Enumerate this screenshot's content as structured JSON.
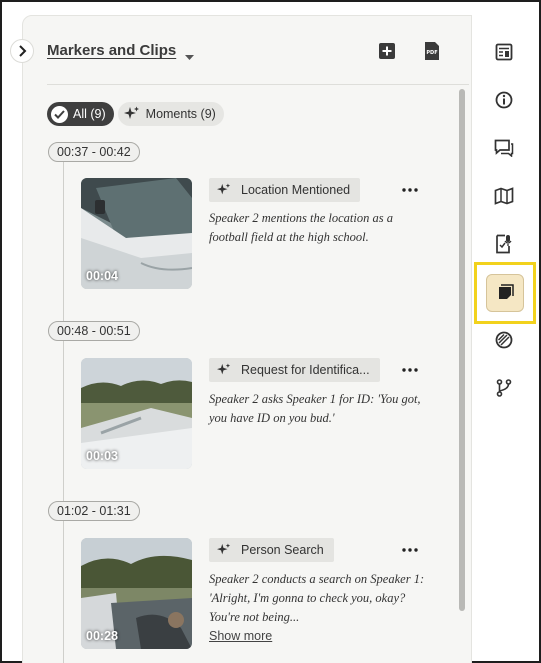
{
  "panel": {
    "title": "Markers and Clips",
    "add_icon": "add-box-icon",
    "pdf_icon": "pdf-export-icon"
  },
  "filters": {
    "all_label": "All (9)",
    "moments_label": "Moments (9)"
  },
  "clips": [
    {
      "time_range": "00:37 - 00:42",
      "thumb_time": "00:04",
      "tag": "Location Mentioned",
      "description": "Speaker 2 mentions the location as a football field at the high school.",
      "show_more": ""
    },
    {
      "time_range": "00:48 - 00:51",
      "thumb_time": "00:03",
      "tag": "Request for Identifica...",
      "description": "Speaker 2 asks Speaker 1 for ID: 'You got, you have ID on you bud.'",
      "show_more": ""
    },
    {
      "time_range": "01:02 - 01:31",
      "thumb_time": "00:28",
      "tag": "Person Search",
      "description": "Speaker 2 conducts a search on Speaker 1: 'Alright, I'm gonna to check you, okay? You're not being...",
      "show_more": "Show more"
    }
  ],
  "rail": {
    "items": [
      "document-details-icon",
      "info-icon",
      "comments-icon",
      "map-icon",
      "transcript-icon",
      "markers-clips-icon",
      "redaction-icon",
      "branch-icon"
    ],
    "active": "markers-clips-icon",
    "highlight_color": "#f2d21c",
    "active_bg": "#f5e7c4"
  }
}
